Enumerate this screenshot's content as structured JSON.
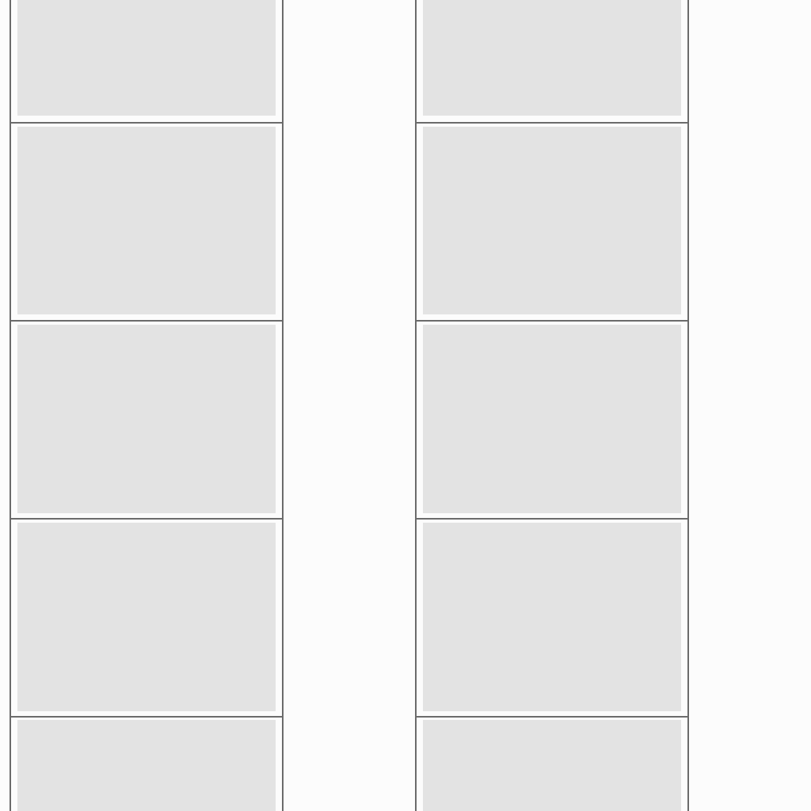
{
  "strips": [
    {
      "id": "left",
      "frames": 5
    },
    {
      "id": "right",
      "frames": 5
    }
  ],
  "colors": {
    "background": "#fcfcfc",
    "frame_border": "#6b6b6b",
    "placeholder": "#e3e3e3"
  }
}
